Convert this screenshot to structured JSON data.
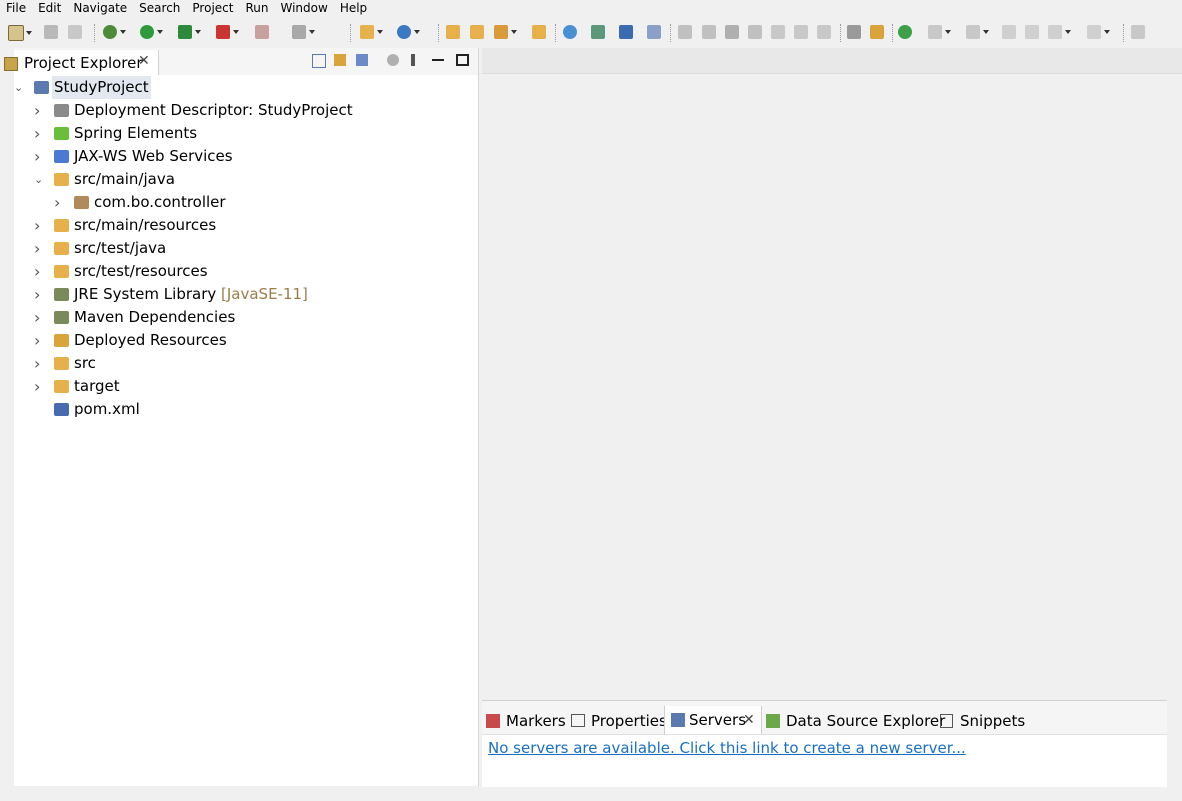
{
  "menubar": {
    "items": [
      "File",
      "Edit",
      "Navigate",
      "Search",
      "Project",
      "Run",
      "Window",
      "Help"
    ]
  },
  "explorer": {
    "tab_label": "Project Explorer",
    "close_glyph": "✕",
    "tree": [
      {
        "label": "StudyProject",
        "icon": "project-icon",
        "level": 0,
        "twisty": "expanded",
        "selected": true
      },
      {
        "label": "Deployment Descriptor: StudyProject",
        "icon": "deployment-descriptor-icon",
        "level": 1,
        "twisty": "collapsed"
      },
      {
        "label": "Spring Elements",
        "icon": "spring-leaf-icon",
        "level": 1,
        "twisty": "collapsed"
      },
      {
        "label": "JAX-WS Web Services",
        "icon": "web-services-icon",
        "level": 1,
        "twisty": "collapsed"
      },
      {
        "label": "src/main/java",
        "icon": "source-folder-icon",
        "level": 1,
        "twisty": "expanded"
      },
      {
        "label": "com.bo.controller",
        "icon": "package-icon",
        "level": 2,
        "twisty": "collapsed"
      },
      {
        "label": "src/main/resources",
        "icon": "source-folder-icon",
        "level": 1,
        "twisty": "collapsed"
      },
      {
        "label": "src/test/java",
        "icon": "source-folder-icon",
        "level": 1,
        "twisty": "collapsed"
      },
      {
        "label": "src/test/resources",
        "icon": "source-folder-icon",
        "level": 1,
        "twisty": "collapsed"
      },
      {
        "label": "JRE System Library",
        "suffix": "[JavaSE-11]",
        "icon": "library-icon",
        "level": 1,
        "twisty": "collapsed"
      },
      {
        "label": "Maven Dependencies",
        "icon": "library-icon",
        "level": 1,
        "twisty": "collapsed"
      },
      {
        "label": "Deployed Resources",
        "icon": "deployed-resources-icon",
        "level": 1,
        "twisty": "collapsed"
      },
      {
        "label": "src",
        "icon": "folder-icon",
        "level": 1,
        "twisty": "collapsed"
      },
      {
        "label": "target",
        "icon": "folder-icon",
        "level": 1,
        "twisty": "collapsed"
      },
      {
        "label": "pom.xml",
        "icon": "maven-file-icon",
        "level": 1,
        "twisty": "none"
      }
    ]
  },
  "bottom_panel": {
    "tabs": [
      {
        "label": "Markers",
        "icon": "markers-icon",
        "active": false
      },
      {
        "label": "Properties",
        "icon": "properties-icon",
        "active": false
      },
      {
        "label": "Servers",
        "icon": "servers-icon",
        "active": true
      },
      {
        "label": "Data Source Explorer",
        "icon": "data-source-icon",
        "active": false
      },
      {
        "label": "Snippets",
        "icon": "snippets-icon",
        "active": false
      }
    ],
    "close_glyph": "✕",
    "servers_link": "No servers are available. Click this link to create a new server..."
  },
  "colors": {
    "selection": "#e3e7ef",
    "link": "#1a6fc4",
    "suffix": "#9a7d4a"
  }
}
